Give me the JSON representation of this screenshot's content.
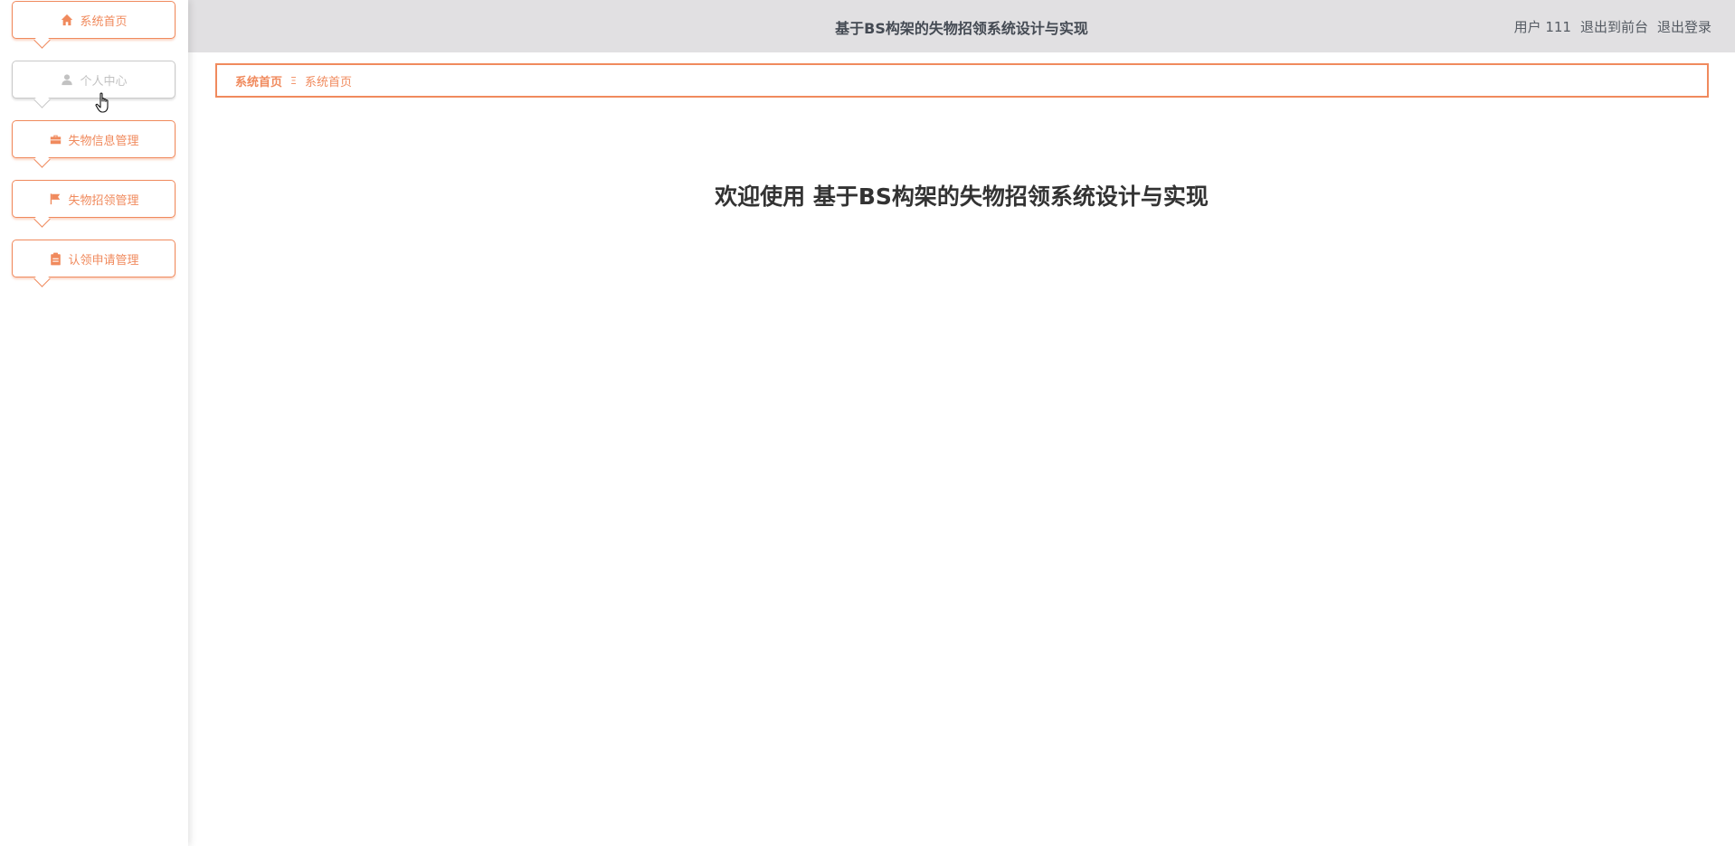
{
  "app": {
    "title": "基于BS构架的失物招领系统设计与实现"
  },
  "header": {
    "user_label": "用户 111",
    "back_to_front_label": "退出到前台",
    "logout_label": "退出登录"
  },
  "sidebar": {
    "items": [
      {
        "label": "系统首页",
        "icon": "home-icon"
      },
      {
        "label": "个人中心",
        "icon": "user-icon",
        "hovered": true
      },
      {
        "label": "失物信息管理",
        "icon": "briefcase-icon"
      },
      {
        "label": "失物招领管理",
        "icon": "flag-icon"
      },
      {
        "label": "认领申请管理",
        "icon": "clipboard-icon"
      }
    ]
  },
  "breadcrumb": {
    "home": "系统首页",
    "separator": "Ξ",
    "current": "系统首页"
  },
  "main": {
    "welcome": "欢迎使用 基于BS构架的失物招领系统设计与实现"
  },
  "colors": {
    "accent": "#f08a5d",
    "header_bg": "#e1e0e2",
    "hover_gray": "#c2c2c2"
  }
}
